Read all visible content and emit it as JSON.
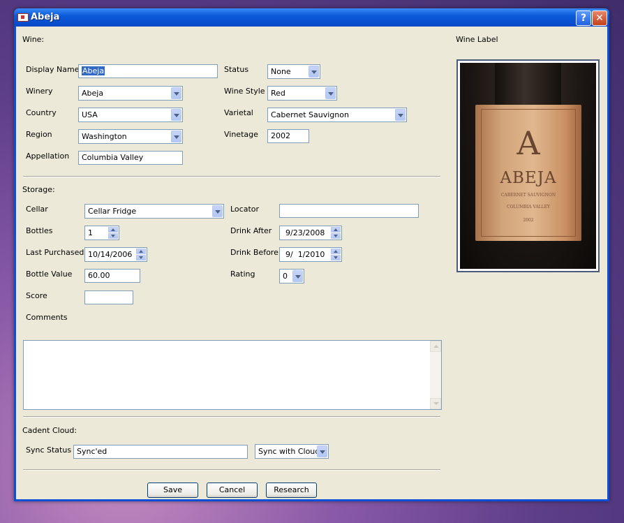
{
  "window": {
    "title": "Abeja",
    "help_glyph": "?",
    "close_glyph": "✕"
  },
  "wine": {
    "section_label": "Wine:",
    "display_name_label": "Display Name",
    "display_name_value": "Abeja",
    "winery_label": "Winery",
    "winery_value": "Abeja",
    "country_label": "Country",
    "country_value": "USA",
    "region_label": "Region",
    "region_value": "Washington",
    "appellation_label": "Appellation",
    "appellation_value": "Columbia Valley",
    "status_label": "Status",
    "status_value": "None",
    "wine_style_label": "Wine Style",
    "wine_style_value": "Red",
    "varietal_label": "Varietal",
    "varietal_value": "Cabernet Sauvignon",
    "vintage_label": "Vinetage",
    "vintage_value": "2002"
  },
  "storage": {
    "section_label": "Storage:",
    "cellar_label": "Cellar",
    "cellar_value": "Cellar Fridge",
    "bottles_label": "Bottles",
    "bottles_value": "1",
    "last_purchased_label": "Last Purchased",
    "last_purchased_value": "10/14/2006",
    "bottle_value_label": "Bottle Value",
    "bottle_value_value": "60.00",
    "score_label": "Score",
    "score_value": "",
    "locator_label": "Locator",
    "locator_value": "",
    "drink_after_label": "Drink After",
    "drink_after_value": "9/23/2008",
    "drink_before_label": "Drink Before",
    "drink_before_value": "9/  1/2010",
    "rating_label": "Rating",
    "rating_value": "0",
    "comments_label": "Comments",
    "comments_value": ""
  },
  "cloud": {
    "section_label": "Cadent Cloud:",
    "sync_status_label": "Sync Status",
    "sync_status_value": "Sync'ed",
    "sync_option_value": "Sync with Cloud"
  },
  "wine_label_panel": {
    "title": "Wine Label",
    "photo_text": {
      "monogram": "A",
      "name": "ABEJA",
      "line1": "CABERNET SAUVIGNON",
      "line2": "COLUMBIA VALLEY",
      "line3": "2002"
    }
  },
  "buttons": {
    "save": "Save",
    "cancel": "Cancel",
    "research": "Research"
  },
  "colors": {
    "titlebar": "#0a5bd9",
    "dialog_bg": "#ece9d8",
    "input_border": "#7f9db9",
    "selection": "#316ac5"
  }
}
